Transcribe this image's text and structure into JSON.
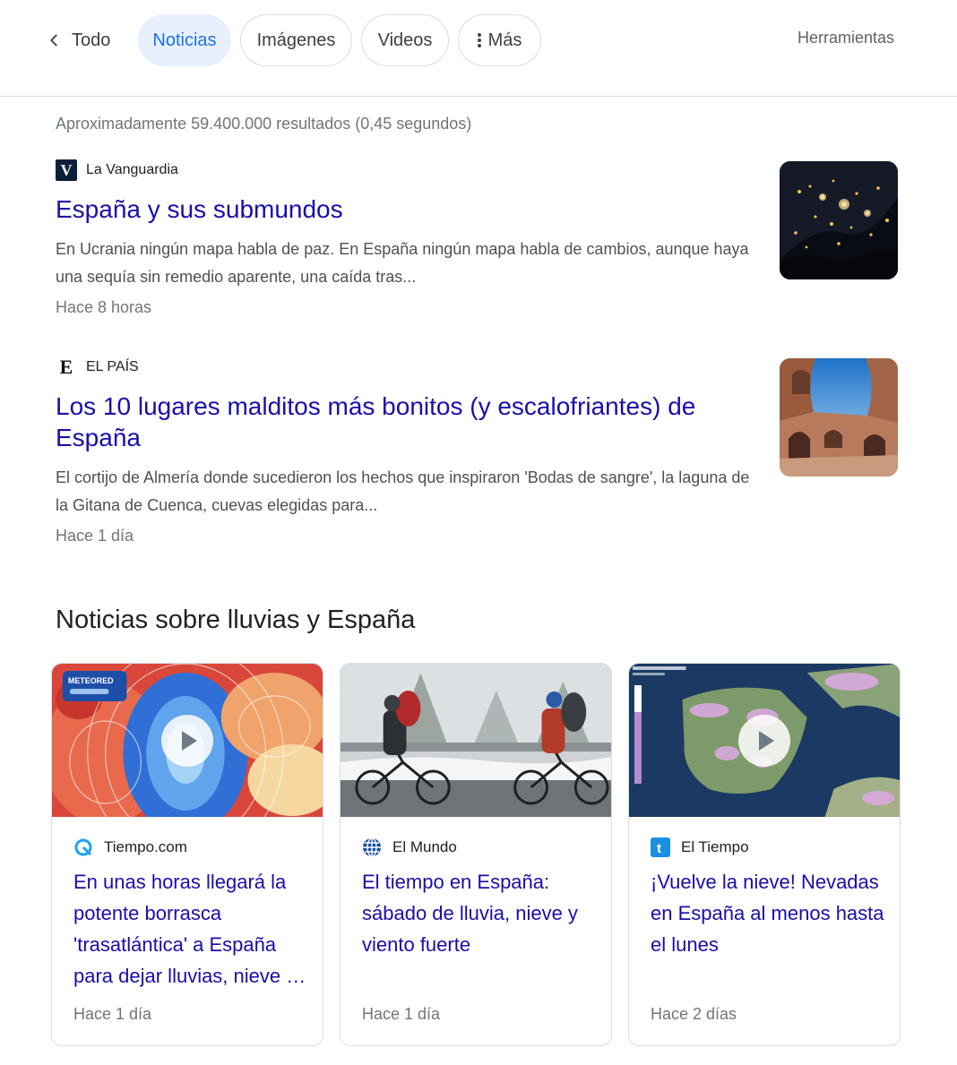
{
  "nav": {
    "back_label": "Todo",
    "chips": [
      "Noticias",
      "Imágenes",
      "Videos",
      "Más"
    ],
    "active_chip": "Noticias",
    "tools_label": "Herramientas"
  },
  "stats": "Aproximadamente 59.400.000 resultados (0,45 segundos)",
  "results": [
    {
      "source": "La Vanguardia",
      "favicon_letter": "V",
      "title": "España y sus submundos",
      "snippet": "En Ucrania ningún mapa habla de paz. En España ningún mapa habla de cambios, aunque haya una sequía sin remedio aparente, una caída tras...",
      "time": "Hace 8 horas",
      "thumbnail": "night-satellite-image"
    },
    {
      "source": "EL PAÍS",
      "favicon_letter": "E",
      "title": "Los 10 lugares malditos más bonitos (y escalofriantes) de España",
      "snippet": "El cortijo de Almería donde sucedieron los hechos que inspiraron 'Bodas de sangre', la laguna de la Gitana de Cuenca, cuevas elegidas para...",
      "time": "Hace 1 día",
      "thumbnail": "ruins-arches-image"
    }
  ],
  "top_stories": {
    "heading": "Noticias sobre lluvias y España",
    "cards": [
      {
        "source": "Tiempo.com",
        "icon": "tiempo-com-icon",
        "image_text": "METEORED",
        "title": "En unas horas llegará la potente borrasca 'trasatlántica' a España para dejar lluvias, nieve y viento",
        "time": "Hace 1 día",
        "video": true
      },
      {
        "source": "El Mundo",
        "icon": "globe-icon",
        "title": "El tiempo en España: sábado de lluvia, nieve y viento fuerte",
        "time": "Hace 1 día",
        "video": false
      },
      {
        "source": "El Tiempo",
        "icon": "el-tiempo-icon",
        "icon_letter": "t",
        "title": "¡Vuelve la nieve! Nevadas en España al menos hasta el lunes",
        "time": "Hace 2 días",
        "video": true
      }
    ]
  },
  "colors": {
    "link": "#1a0dab",
    "active_chip_bg": "#e8f0fe",
    "active_chip_text": "#1a73e8"
  }
}
